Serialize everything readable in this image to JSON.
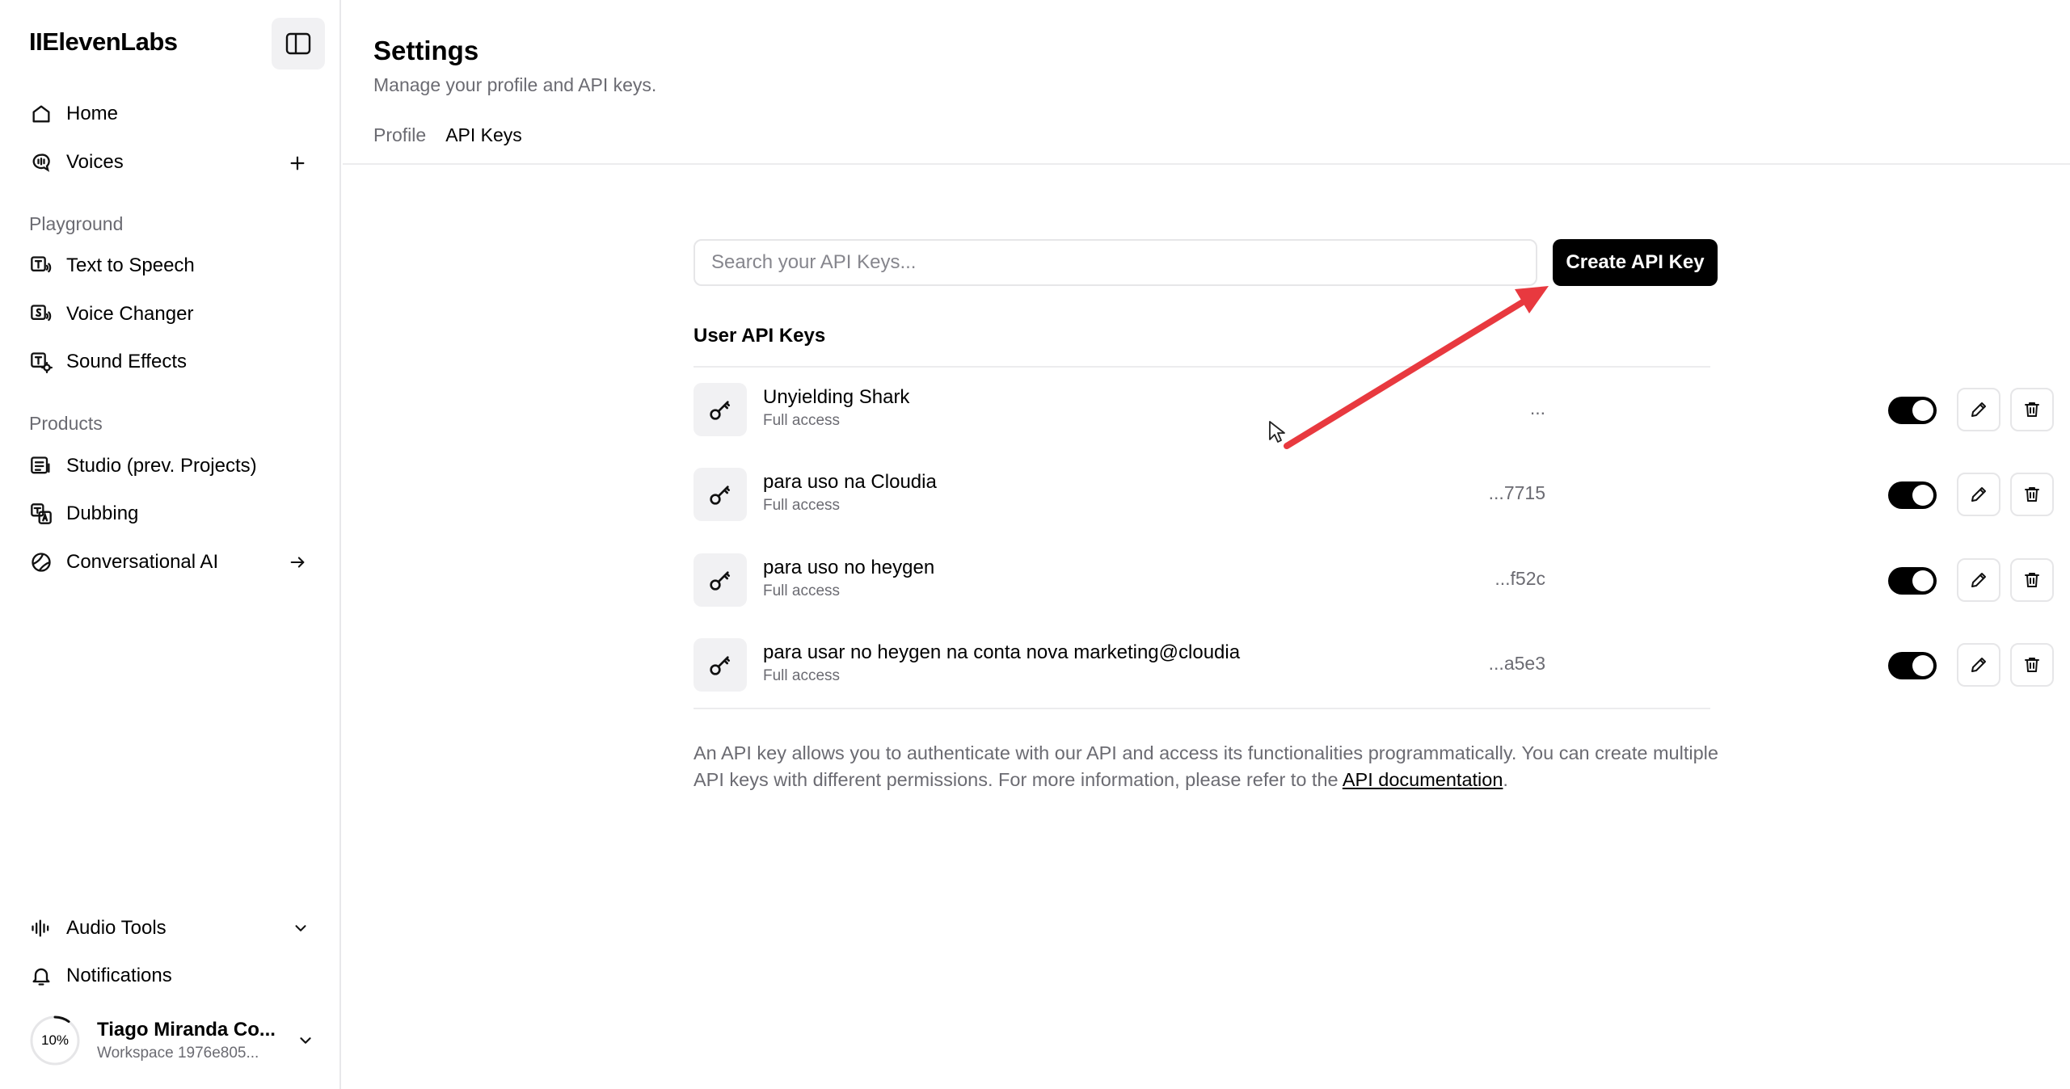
{
  "brand": {
    "logo": "IIElevenLabs"
  },
  "sidebar": {
    "nav_top": [
      {
        "label": "Home",
        "icon": "home-icon"
      },
      {
        "label": "Voices",
        "icon": "voices-icon"
      }
    ],
    "playground_label": "Playground",
    "playground": [
      {
        "label": "Text to Speech",
        "icon": "text-to-speech-icon"
      },
      {
        "label": "Voice Changer",
        "icon": "voice-changer-icon"
      },
      {
        "label": "Sound Effects",
        "icon": "sound-effects-icon"
      }
    ],
    "products_label": "Products",
    "products": [
      {
        "label": "Studio (prev. Projects)",
        "icon": "studio-icon"
      },
      {
        "label": "Dubbing",
        "icon": "dubbing-icon"
      },
      {
        "label": "Conversational AI",
        "icon": "conversational-ai-icon"
      }
    ],
    "bottom": [
      {
        "label": "Audio Tools",
        "icon": "audio-tools-icon"
      },
      {
        "label": "Notifications",
        "icon": "bell-icon"
      }
    ],
    "user": {
      "name": "Tiago Miranda Co...",
      "workspace": "Workspace 1976e805...",
      "usage": "10%",
      "usage_fraction": 0.1
    }
  },
  "header": {
    "title": "Settings",
    "subtitle": "Manage your profile and API keys.",
    "tabs": [
      {
        "label": "Profile",
        "active": false
      },
      {
        "label": "API Keys",
        "active": true
      }
    ]
  },
  "api_keys": {
    "search_placeholder": "Search your API Keys...",
    "create_label": "Create API Key",
    "heading": "User API Keys",
    "keys": [
      {
        "name": "Unyielding Shark",
        "access": "Full access",
        "suffix": "...",
        "enabled": true
      },
      {
        "name": "para uso na Cloudia",
        "access": "Full access",
        "suffix": "...7715",
        "enabled": true
      },
      {
        "name": "para uso no heygen",
        "access": "Full access",
        "suffix": "...f52c",
        "enabled": true
      },
      {
        "name": "para usar no heygen na conta nova marketing@cloudia",
        "access": "Full access",
        "suffix": "...a5e3",
        "enabled": true
      }
    ],
    "info_text": "An API key allows you to authenticate with our API and access its functionalities programmatically. You can create multiple API keys with different permissions. For more information, please refer to the ",
    "info_link": "API documentation",
    "info_end": "."
  },
  "colors": {
    "annotation_arrow": "#e8393f",
    "primary_button": "#000000",
    "muted_text": "#6b6b72"
  }
}
